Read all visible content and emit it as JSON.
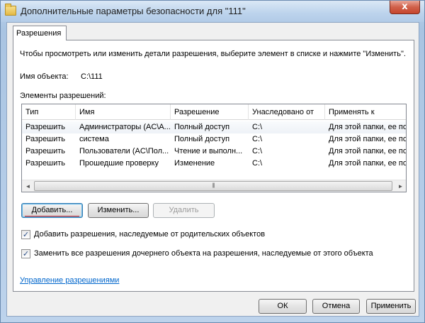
{
  "window": {
    "title": "Дополнительные параметры безопасности  для \"111\"",
    "close_glyph": "x"
  },
  "tabs": [
    {
      "label": "Разрешения"
    }
  ],
  "panel": {
    "instruction": "Чтобы просмотреть или изменить детали разрешения, выберите элемент в списке и нажмите \"Изменить\".",
    "object_name_label": "Имя объекта:",
    "object_name_value": "C:\\111",
    "entries_label": "Элементы разрешений:"
  },
  "table": {
    "columns": [
      "Тип",
      "Имя",
      "Разрешение",
      "Унаследовано от",
      "Применять к"
    ],
    "rows": [
      [
        "Разрешить",
        "Администраторы (AC\\A...",
        "Полный доступ",
        "C:\\",
        "Для этой папки, ее под"
      ],
      [
        "Разрешить",
        "система",
        "Полный доступ",
        "C:\\",
        "Для этой папки, ее под"
      ],
      [
        "Разрешить",
        "Пользователи (AC\\Пол...",
        "Чтение и выполн...",
        "C:\\",
        "Для этой папки, ее под"
      ],
      [
        "Разрешить",
        "Прошедшие проверку",
        "Изменение",
        "C:\\",
        "Для этой папки, ее под"
      ]
    ],
    "scroll_left": "◄",
    "scroll_right": "►",
    "thumb_grip": "|||"
  },
  "buttons": {
    "add": "Добавить...",
    "edit": "Изменить...",
    "remove": "Удалить",
    "ok": "ОК",
    "cancel": "Отмена",
    "apply": "Применить"
  },
  "options": {
    "inherit_label": "Добавить разрешения, наследуемые от родительских объектов",
    "inherit_checked": true,
    "replace_label": "Заменить все разрешения дочернего объекта на разрешения, наследуемые от этого объекта",
    "replace_checked": true,
    "check_glyph": "✓"
  },
  "manage_link": "Управление разрешениями",
  "colors": {
    "link": "#0066cc",
    "focus_underline": "#d21818",
    "close_button": "#c7452d"
  }
}
